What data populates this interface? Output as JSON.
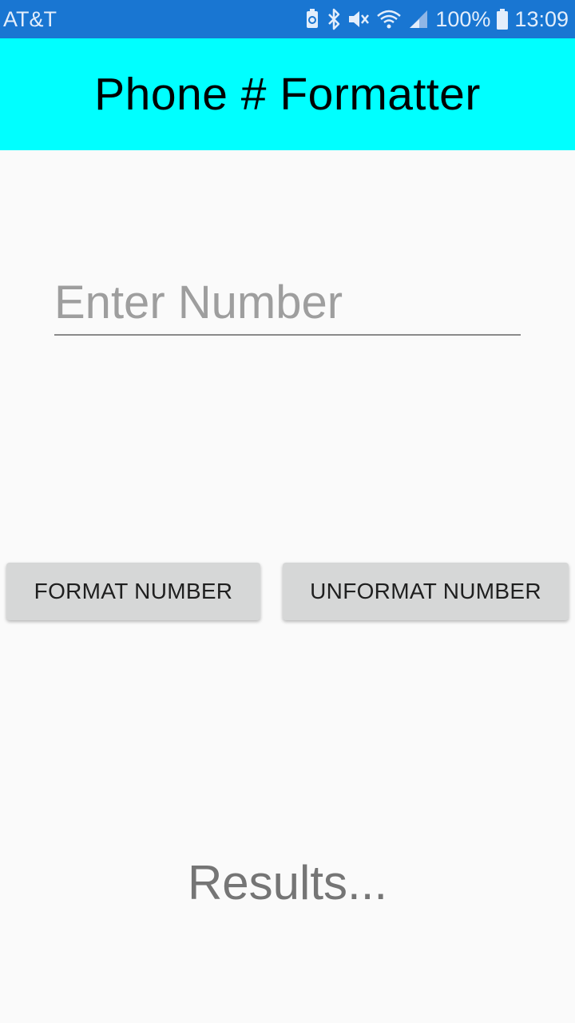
{
  "status_bar": {
    "carrier": "AT&T",
    "battery": "100%",
    "time": "13:09",
    "icons": [
      "data-saver-icon",
      "bluetooth-icon",
      "mute-icon",
      "wifi-icon",
      "signal-icon",
      "battery-icon"
    ],
    "background": "#1976d2"
  },
  "app_bar": {
    "title": "Phone # Formatter",
    "background": "#00ffff"
  },
  "input": {
    "placeholder": "Enter Number",
    "value": ""
  },
  "buttons": {
    "format_label": "FORMAT NUMBER",
    "unformat_label": "UNFORMAT NUMBER"
  },
  "results": {
    "text": "Results..."
  }
}
